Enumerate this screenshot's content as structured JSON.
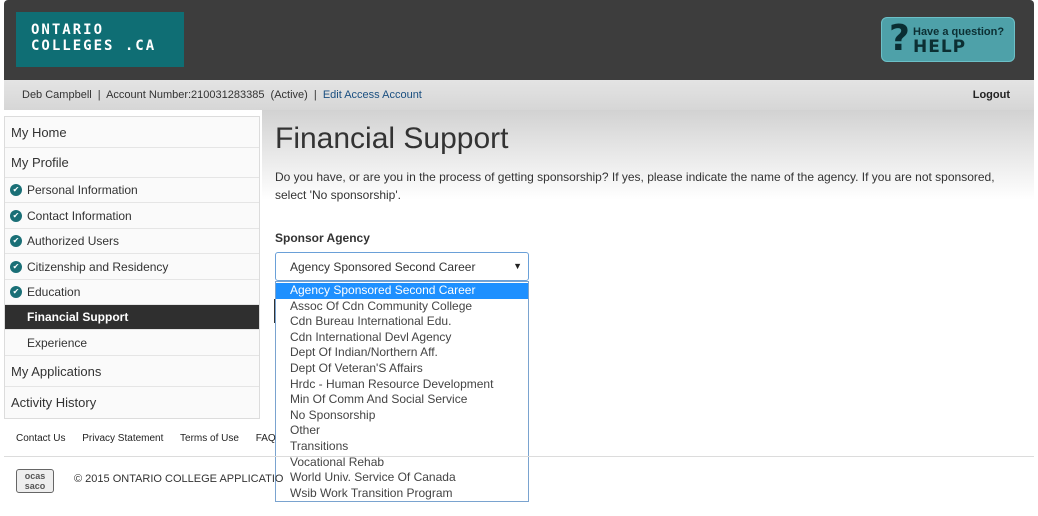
{
  "header": {
    "logo_line1": "ONTARIO",
    "logo_line2": "COLLEGES .CA",
    "help_small": "Have a question?",
    "help_big": "HELP"
  },
  "account": {
    "name": "Deb Campbell",
    "separator": "|",
    "account_number": "Account Number:210031283385",
    "status": "(Active)",
    "edit_link": "Edit Access Account",
    "logout": "Logout"
  },
  "sidebar": {
    "items": [
      {
        "label": "My Home",
        "type": "top"
      },
      {
        "label": "My Profile",
        "type": "top"
      },
      {
        "label": "Personal Information",
        "type": "sub",
        "done": true
      },
      {
        "label": "Contact Information",
        "type": "sub",
        "done": true
      },
      {
        "label": "Authorized Users",
        "type": "sub",
        "done": true
      },
      {
        "label": "Citizenship and Residency",
        "type": "sub",
        "done": true
      },
      {
        "label": "Education",
        "type": "sub",
        "done": true
      },
      {
        "label": "Financial Support",
        "type": "sub",
        "active": true
      },
      {
        "label": "Experience",
        "type": "sub"
      },
      {
        "label": "My Applications",
        "type": "top"
      },
      {
        "label": "Activity History",
        "type": "top"
      }
    ]
  },
  "main": {
    "title": "Financial Support",
    "description": "Do you have, or are you in the process of getting sponsorship? If yes, please indicate the name of the agency. If you are not sponsored, select 'No sponsorship'.",
    "sponsor_label": "Sponsor Agency",
    "selected_value": "Agency Sponsored Second Career",
    "options": [
      "Agency Sponsored Second Career",
      "Assoc Of Cdn Community College",
      "Cdn Bureau International Edu.",
      "Cdn International Devl Agency",
      "Dept Of Indian/Northern Aff.",
      "Dept Of Veteran'S Affairs",
      "Hrdc - Human Resource Development",
      "Min Of Comm And Social Service",
      "No Sponsorship",
      "Other",
      "Transitions",
      "Vocational Rehab",
      "World Univ. Service Of Canada",
      "Wsib Work Transition Program"
    ]
  },
  "footer": {
    "links": [
      "Contact Us",
      "Privacy Statement",
      "Terms of Use",
      "FAQ"
    ],
    "ocas_logo": "ocas saco",
    "copyright": "© 2015 ONTARIO COLLEGE APPLICATIO"
  },
  "colors": {
    "header_bg": "#3d3d3d",
    "brand_teal": "#0f6e74",
    "help_bg": "#4ea1a9",
    "dropdown_highlight": "#1e90ff"
  }
}
